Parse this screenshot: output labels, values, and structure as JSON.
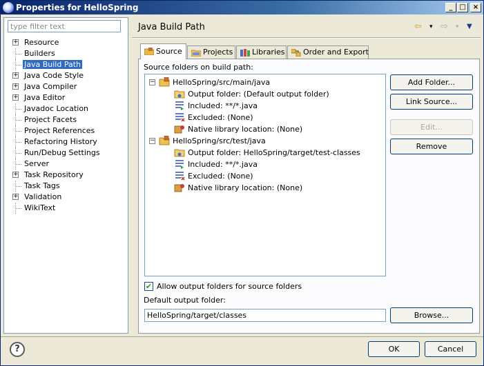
{
  "window": {
    "title": "Properties for HelloSpring",
    "min_glyph": "_",
    "max_glyph": "□",
    "close_glyph": "×"
  },
  "filter": {
    "placeholder": "type filter text",
    "value": ""
  },
  "nav": [
    {
      "label": "Resource",
      "expandable": true
    },
    {
      "label": "Builders",
      "expandable": false
    },
    {
      "label": "Java Build Path",
      "expandable": false,
      "selected": true
    },
    {
      "label": "Java Code Style",
      "expandable": true
    },
    {
      "label": "Java Compiler",
      "expandable": true
    },
    {
      "label": "Java Editor",
      "expandable": true
    },
    {
      "label": "Javadoc Location",
      "expandable": false
    },
    {
      "label": "Project Facets",
      "expandable": false
    },
    {
      "label": "Project References",
      "expandable": false
    },
    {
      "label": "Refactoring History",
      "expandable": false
    },
    {
      "label": "Run/Debug Settings",
      "expandable": false
    },
    {
      "label": "Server",
      "expandable": false
    },
    {
      "label": "Task Repository",
      "expandable": true
    },
    {
      "label": "Task Tags",
      "expandable": false
    },
    {
      "label": "Validation",
      "expandable": true
    },
    {
      "label": "WikiText",
      "expandable": false
    }
  ],
  "page": {
    "title": "Java Build Path",
    "back_glyph": "⇦",
    "forward_glyph": "⇨",
    "menu_glyph": "▼",
    "dropdown_glyph": "▾"
  },
  "tabs": [
    {
      "label": "Source",
      "active": true,
      "icon": "source-folder-icon"
    },
    {
      "label": "Projects",
      "active": false,
      "icon": "projects-icon"
    },
    {
      "label": "Libraries",
      "active": false,
      "icon": "libraries-icon"
    },
    {
      "label": "Order and Export",
      "active": false,
      "icon": "order-export-icon"
    }
  ],
  "source": {
    "label": "Source folders on build path:",
    "tree": [
      {
        "label": "HelloSpring/src/main/java",
        "icon": "package-folder-icon",
        "children": [
          {
            "label": "Output folder: (Default output folder)",
            "icon": "output-folder-icon"
          },
          {
            "label": "Included: **/*.java",
            "icon": "included-filter-icon"
          },
          {
            "label": "Excluded: (None)",
            "icon": "excluded-filter-icon"
          },
          {
            "label": "Native library location: (None)",
            "icon": "native-library-icon"
          }
        ]
      },
      {
        "label": "HelloSpring/src/test/java",
        "icon": "package-folder-icon",
        "children": [
          {
            "label": "Output folder: HelloSpring/target/test-classes",
            "icon": "output-folder-icon"
          },
          {
            "label": "Included: **/*.java",
            "icon": "included-filter-icon"
          },
          {
            "label": "Excluded: (None)",
            "icon": "excluded-filter-icon"
          },
          {
            "label": "Native library location: (None)",
            "icon": "native-library-icon"
          }
        ]
      }
    ],
    "buttons": {
      "add_folder": "Add Folder...",
      "link_source": "Link Source...",
      "edit": "Edit...",
      "remove": "Remove"
    },
    "allow_output_label": "Allow output folders for source folders",
    "allow_output_checked": true,
    "check_glyph": "✔",
    "default_output_label": "Default output folder:",
    "default_output_value": "HelloSpring/target/classes",
    "browse": "Browse..."
  },
  "footer": {
    "help_glyph": "?",
    "ok": "OK",
    "cancel": "Cancel"
  }
}
